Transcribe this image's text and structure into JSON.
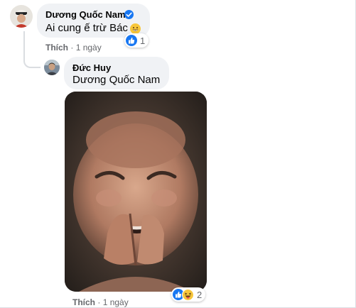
{
  "comments": [
    {
      "author": "Dương Quốc Nam",
      "verified": true,
      "text": "Ai cung ế trừ Bác",
      "inline_emoji": "grinning-face",
      "reaction_icons": [
        "like"
      ],
      "reaction_count": "1",
      "action_like": "Thích",
      "separator": "·",
      "time": "1 ngày"
    },
    {
      "author": "Đức Huy",
      "mention": "Dương Quốc Nam",
      "attachment": "laughing-baby-gif",
      "reaction_icons": [
        "like",
        "haha"
      ],
      "reaction_count": "2",
      "action_like": "Thích",
      "separator": "·",
      "time": "1 ngày"
    }
  ],
  "colors": {
    "bubble": "#f0f2f5",
    "like_blue": "#1877f2",
    "haha_yellow": "#f7c63b",
    "meta_gray": "#65676b"
  }
}
